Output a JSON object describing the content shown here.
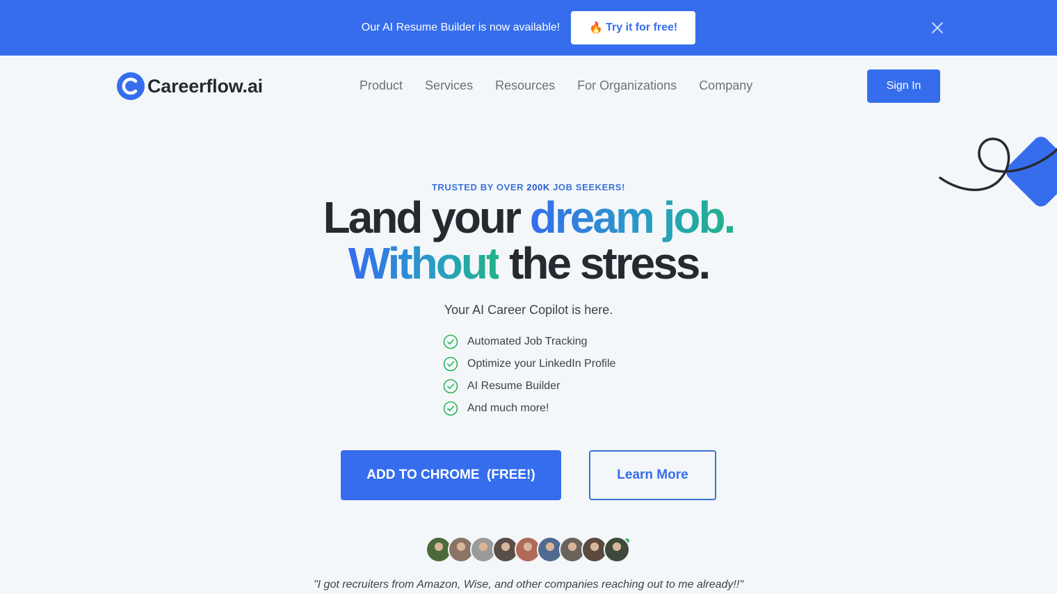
{
  "announcement": {
    "text": "Our AI Resume Builder is now available!",
    "button_icon": "fire-emoji",
    "button_emoji": "🔥",
    "button_label": "Try it for free!",
    "close_icon": "close-icon"
  },
  "nav": {
    "logo_text": "Careerflow.ai",
    "links": [
      "Product",
      "Services",
      "Resources",
      "For Organizations",
      "Company"
    ],
    "sign_in_label": "Sign In"
  },
  "hero": {
    "trusted_prefix": "TRUSTED BY OVER ",
    "trusted_highlight": "200K",
    "trusted_suffix": " JOB SEEKERS!",
    "headline_line1_plain": "Land your ",
    "headline_line1_grad": "dream job.",
    "headline_line2_grad": "Without",
    "headline_line2_plain": " the stress.",
    "subheadline": "Your AI Career Copilot is here.",
    "features": [
      "Automated Job Tracking",
      "Optimize your LinkedIn Profile",
      "AI Resume Builder",
      "And much more!"
    ],
    "primary_cta": "ADD TO CHROME  (FREE!)",
    "secondary_cta": "Learn More",
    "testimonial": "\"I got recruiters from Amazon, Wise, and other companies reaching out to me already!!\""
  },
  "avatars": {
    "count": 9,
    "colors": [
      "#4a6a3a",
      "#8a7466",
      "#9a9a9a",
      "#5a4e48",
      "#b06a58",
      "#4e6a90",
      "#6a645c",
      "#5a4a40",
      "#3e4a3a"
    ]
  },
  "colors": {
    "brand": "#356ded",
    "gradient_start": "#356ded",
    "gradient_end": "#21b487",
    "check": "#28b45a",
    "text_dark": "#262a30"
  }
}
